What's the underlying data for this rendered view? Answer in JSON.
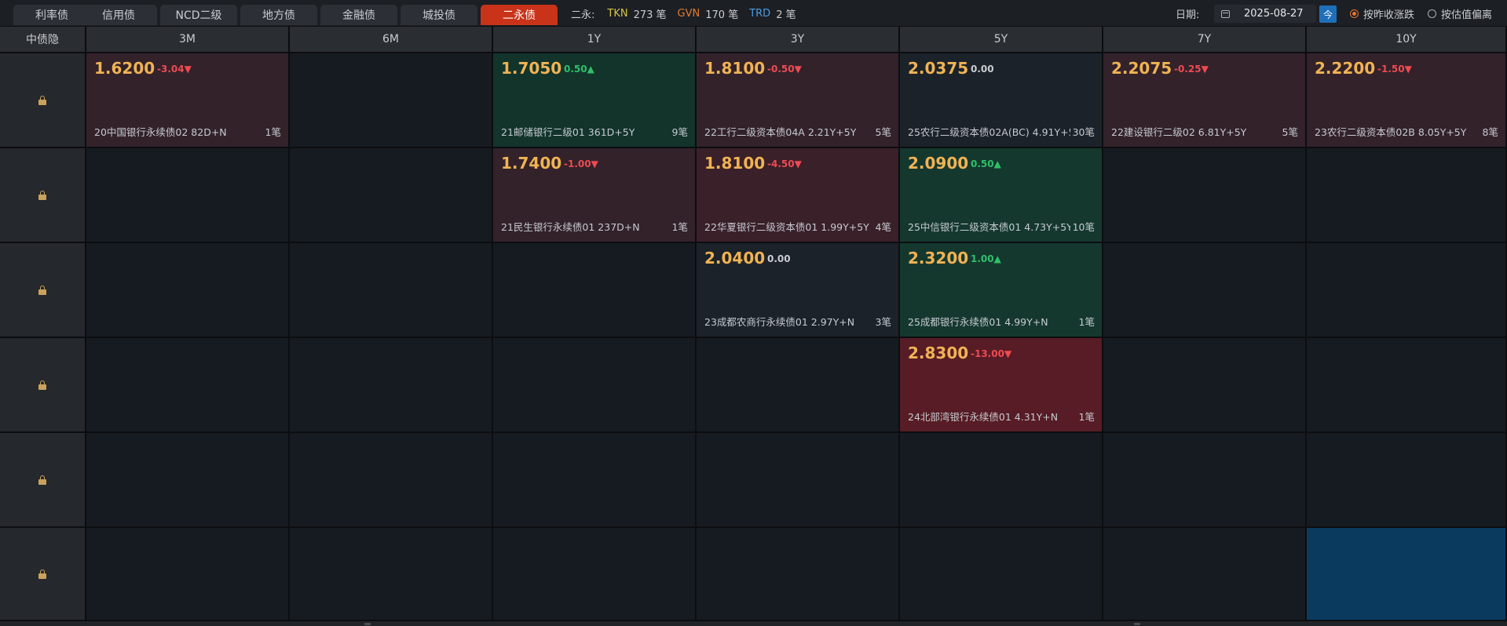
{
  "tabs": [
    {
      "label": "利率债",
      "active": false
    },
    {
      "label": "信用债",
      "active": false
    },
    {
      "label": "NCD二级",
      "active": false
    },
    {
      "label": "地方债",
      "active": false
    },
    {
      "label": "金融债",
      "active": false
    },
    {
      "label": "城投债",
      "active": false
    },
    {
      "label": "二永债",
      "active": true
    }
  ],
  "stats": {
    "label": "二永:",
    "items": [
      {
        "code": "TKN",
        "count": "273 笔",
        "color": "#d6c54a"
      },
      {
        "code": "GVN",
        "count": "170 笔",
        "color": "#e57a2e"
      },
      {
        "code": "TRD",
        "count": "2 笔",
        "color": "#4d9de0"
      }
    ]
  },
  "date": {
    "label": "日期:",
    "value": "2025-08-27",
    "today_label": "今",
    "icon": "calendar-icon"
  },
  "sort_options": [
    {
      "label": "按昨收涨跌",
      "selected": true
    },
    {
      "label": "按估值偏离",
      "selected": false
    }
  ],
  "grid": {
    "corner_label": "中债隐",
    "columns": [
      "3M",
      "6M",
      "1Y",
      "3Y",
      "5Y",
      "7Y",
      "10Y"
    ],
    "row_icon": "lock-icon",
    "row_count": 6,
    "cells": [
      {
        "row": 0,
        "col": 0,
        "style": "red",
        "price": "1.6200",
        "change": "-3.04▼",
        "dir": "down",
        "bond": "20中国银行永续债02 82D+N",
        "count": "1笔"
      },
      {
        "row": 0,
        "col": 2,
        "style": "green",
        "price": "1.7050",
        "change": "0.50▲",
        "dir": "up",
        "bond": "21邮储银行二级01 361D+5Y",
        "count": "9笔"
      },
      {
        "row": 0,
        "col": 3,
        "style": "red",
        "price": "1.8100",
        "change": "-0.50▼",
        "dir": "down",
        "bond": "22工行二级资本债04A 2.21Y+5Y",
        "count": "5笔"
      },
      {
        "row": 0,
        "col": 4,
        "style": "neutral",
        "price": "2.0375",
        "change": "0.00",
        "dir": "flat",
        "bond": "25农行二级资本债02A(BC) 4.91Y+5Y",
        "count": "30笔"
      },
      {
        "row": 0,
        "col": 5,
        "style": "red",
        "price": "2.2075",
        "change": "-0.25▼",
        "dir": "down",
        "bond": "22建设银行二级02 6.81Y+5Y",
        "count": "5笔"
      },
      {
        "row": 0,
        "col": 6,
        "style": "red",
        "price": "2.2200",
        "change": "-1.50▼",
        "dir": "down",
        "bond": "23农行二级资本债02B 8.05Y+5Y",
        "count": "8笔"
      },
      {
        "row": 1,
        "col": 2,
        "style": "red",
        "price": "1.7400",
        "change": "-1.00▼",
        "dir": "down",
        "bond": "21民生银行永续债01 237D+N",
        "count": "1笔"
      },
      {
        "row": 1,
        "col": 3,
        "style": "red2",
        "price": "1.8100",
        "change": "-4.50▼",
        "dir": "down",
        "bond": "22华夏银行二级资本债01 1.99Y+5Y",
        "count": "4笔"
      },
      {
        "row": 1,
        "col": 4,
        "style": "green2",
        "price": "2.0900",
        "change": "0.50▲",
        "dir": "up",
        "bond": "25中信银行二级资本债01 4.73Y+5Y",
        "count": "10笔"
      },
      {
        "row": 2,
        "col": 3,
        "style": "neutral",
        "price": "2.0400",
        "change": "0.00",
        "dir": "flat",
        "bond": "23成都农商行永续债01 2.97Y+N",
        "count": "3笔"
      },
      {
        "row": 2,
        "col": 4,
        "style": "green2",
        "price": "2.3200",
        "change": "1.00▲",
        "dir": "up",
        "bond": "25成都银行永续债01 4.99Y+N",
        "count": "1笔"
      },
      {
        "row": 3,
        "col": 4,
        "style": "deepred",
        "price": "2.8300",
        "change": "-13.00▼",
        "dir": "down",
        "bond": "24北部湾银行永续债01 4.31Y+N",
        "count": "1笔"
      },
      {
        "row": 5,
        "col": 6,
        "style": "blue"
      }
    ]
  },
  "colors": {
    "accent_tab": "#c8331a",
    "price": "#f0b354",
    "down": "#ef4a52",
    "up": "#2fbf6a"
  }
}
